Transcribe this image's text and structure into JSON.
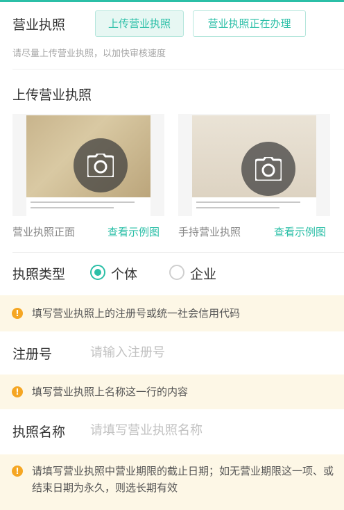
{
  "license_section": {
    "title": "营业执照",
    "options": [
      "上传营业执照",
      "营业执照正在办理"
    ],
    "active_option": "上传营业执照",
    "hint": "请尽量上传营业执照，以加快审核速度"
  },
  "upload_section": {
    "title": "上传营业执照",
    "photos": [
      {
        "label": "营业执照正面",
        "link": "查看示例图",
        "icon": "camera-icon"
      },
      {
        "label": "手持营业执照",
        "link": "查看示例图",
        "icon": "camera-icon"
      }
    ]
  },
  "license_type": {
    "label": "执照类型",
    "options": [
      {
        "label": "个体",
        "selected": true
      },
      {
        "label": "企业",
        "selected": false
      }
    ]
  },
  "notices": [
    "填写营业执照上的注册号或统一社会信用代码",
    "填写营业执照上名称这一行的内容",
    "请填写营业执照中营业期限的截止日期；如无营业期限这一项、或结束日期为永久，则选长期有效"
  ],
  "fields": {
    "registration": {
      "label": "注册号",
      "placeholder": "请输入注册号",
      "value": ""
    },
    "license_name": {
      "label": "执照名称",
      "placeholder": "请填写营业执照名称",
      "value": ""
    }
  },
  "colors": {
    "accent": "#2bbfa7",
    "notice_bg": "#fdf7e6",
    "notice_icon": "#f5a623"
  }
}
